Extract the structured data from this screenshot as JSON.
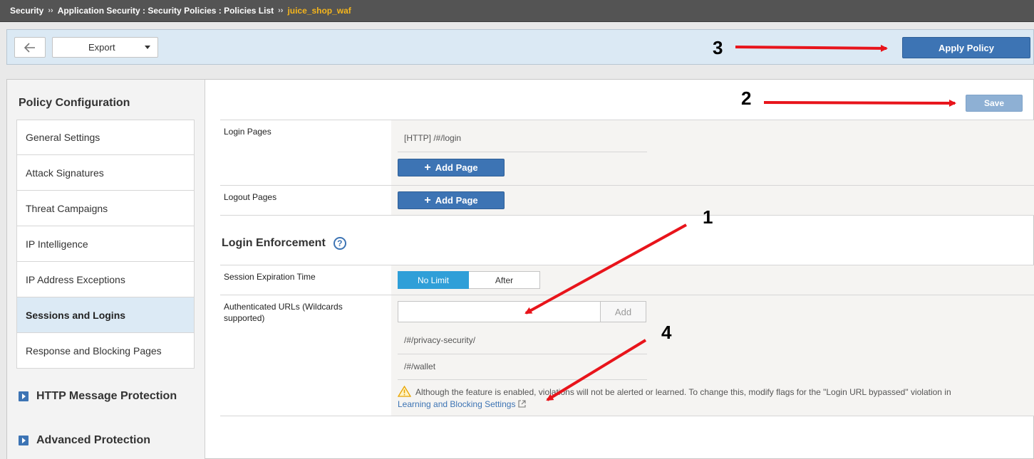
{
  "breadcrumb": {
    "items": [
      "Security",
      "Application Security : Security Policies : Policies List"
    ],
    "separator": "››",
    "current": "juice_shop_waf"
  },
  "toolbar": {
    "back_icon": "arrow-left-icon",
    "export_label": "Export",
    "apply_label": "Apply Policy"
  },
  "sidebar": {
    "title": "Policy Configuration",
    "items": [
      {
        "label": "General Settings",
        "active": false
      },
      {
        "label": "Attack Signatures",
        "active": false
      },
      {
        "label": "Threat Campaigns",
        "active": false
      },
      {
        "label": "IP Intelligence",
        "active": false
      },
      {
        "label": "IP Address Exceptions",
        "active": false
      },
      {
        "label": "Sessions and Logins",
        "active": true
      },
      {
        "label": "Response and Blocking Pages",
        "active": false
      }
    ],
    "groups": [
      "HTTP Message Protection",
      "Advanced Protection"
    ]
  },
  "content": {
    "save_label": "Save",
    "login_pages": {
      "label": "Login Pages",
      "items": [
        "[HTTP] /#/login"
      ],
      "add_label": "Add Page"
    },
    "logout_pages": {
      "label": "Logout Pages",
      "add_label": "Add Page"
    },
    "login_enforcement": {
      "title": "Login Enforcement",
      "help": "?",
      "session_expiration": {
        "label": "Session Expiration Time",
        "options": [
          "No Limit",
          "After"
        ],
        "selected": "No Limit"
      },
      "authenticated_urls": {
        "label": "Authenticated URLs (Wildcards supported)",
        "input_value": "",
        "add_label": "Add",
        "items": [
          "/#/privacy-security/",
          "/#/wallet"
        ]
      },
      "warning": {
        "text": "Although the feature is enabled, violations will not be alerted or learned. To change this, modify flags for the \"Login URL bypassed\" violation in",
        "link": "Learning and Blocking Settings"
      }
    }
  },
  "annotations": {
    "numbers": [
      "1",
      "2",
      "3",
      "4"
    ],
    "arrow_color": "#e8141b"
  }
}
